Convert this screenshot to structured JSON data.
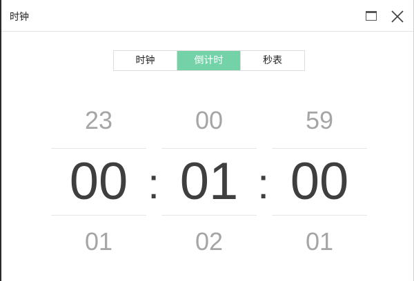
{
  "window": {
    "title": "时钟"
  },
  "tabs": [
    {
      "label": "时钟",
      "active": false
    },
    {
      "label": "倒计时",
      "active": true
    },
    {
      "label": "秒表",
      "active": false
    }
  ],
  "timer": {
    "hours": {
      "prev": "23",
      "current": "00",
      "next": "01"
    },
    "minutes": {
      "prev": "00",
      "current": "01",
      "next": "02"
    },
    "seconds": {
      "prev": "59",
      "current": "00",
      "next": "01"
    },
    "separator": ":"
  },
  "colors": {
    "accent": "#74d2a9",
    "digit_current": "#3f3f3f",
    "digit_faded": "#a5a5a5"
  }
}
